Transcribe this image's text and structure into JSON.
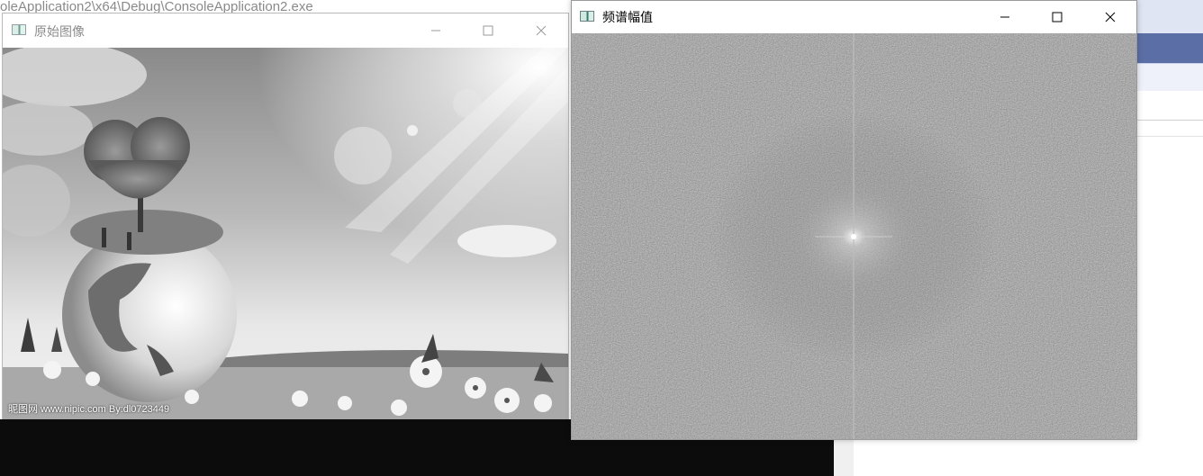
{
  "background": {
    "console_title_fragment": "oleApplication2\\x64\\Debug\\ConsoleApplication2.exe"
  },
  "windows": {
    "original": {
      "title": "原始图像",
      "watermark": "昵图网 www.nipic.com  By:dl0723449",
      "controls": [
        "minimize-icon",
        "maximize-icon",
        "close-icon"
      ]
    },
    "spectrum": {
      "title": "频谱幅值",
      "controls": [
        "minimize-icon",
        "maximize-icon",
        "close-icon"
      ]
    }
  },
  "colors": {
    "console_bg": "#0c0c0c",
    "ide_accent": "#5b6ea6",
    "spectrum_bg": "#555555"
  }
}
